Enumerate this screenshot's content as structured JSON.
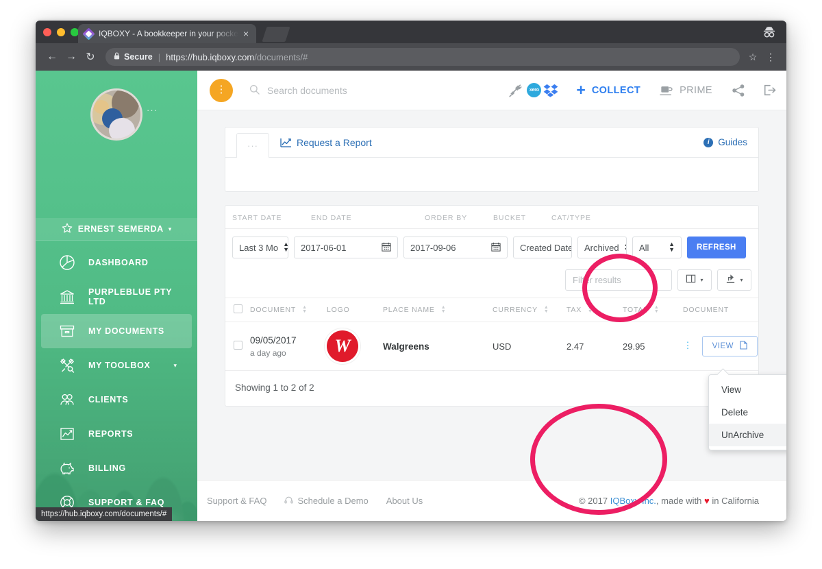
{
  "browser": {
    "tab_title": "IQBOXY - A bookkeeper in your pocket",
    "tab_close": "×",
    "back_icon": "←",
    "forward_icon": "→",
    "reload_icon": "↻",
    "lock_icon": "🔒",
    "secure_label": "Secure",
    "separator": "|",
    "url_scheme": "https://",
    "url_host": "hub.iqboxy.com",
    "url_path": "/documents/#",
    "star_icon": "☆",
    "menu_icon": "⋮",
    "incognito_icon": "incognito-icon",
    "status_url": "https://hub.iqboxy.com/documents/#"
  },
  "sidebar": {
    "avatar_alt": "user-avatar",
    "avatar_dots": "···",
    "user_name": "ERNEST SEMERDA",
    "user_star": "☆",
    "user_caret": "▾",
    "items": [
      {
        "label": "DASHBOARD",
        "icon": "pie-chart-icon",
        "active": false,
        "caret": ""
      },
      {
        "label": "PURPLEBLUE PTY LTD",
        "icon": "bank-icon",
        "active": false,
        "caret": ""
      },
      {
        "label": "MY DOCUMENTS",
        "icon": "box-icon",
        "active": true,
        "caret": ""
      },
      {
        "label": "MY TOOLBOX",
        "icon": "tools-icon",
        "active": false,
        "caret": "▾"
      },
      {
        "label": "CLIENTS",
        "icon": "people-icon",
        "active": false,
        "caret": ""
      },
      {
        "label": "REPORTS",
        "icon": "graph-icon",
        "active": false,
        "caret": ""
      },
      {
        "label": "BILLING",
        "icon": "piggybank-icon",
        "active": false,
        "caret": ""
      },
      {
        "label": "SUPPORT & FAQ",
        "icon": "lifering-icon",
        "active": false,
        "caret": ""
      }
    ]
  },
  "appbar": {
    "menu_dots": "⋮",
    "search_placeholder": "Search documents",
    "search_value": "",
    "plug_icon": "plug-icon",
    "xero_label": "xero",
    "dropbox_icon": "dropbox-icon",
    "collect_plus": "+",
    "collect_label": "COLLECT",
    "prime_label": "PRIME",
    "prime_icon": "coffee-cup-icon",
    "share_icon": "share-icon",
    "logout_icon": "logout-icon"
  },
  "report_card": {
    "ellipsis": "···",
    "request_report": "Request a Report",
    "guides": "Guides",
    "guides_badge": "i"
  },
  "filters": {
    "headers": [
      "START DATE",
      "END DATE",
      "ORDER BY",
      "BUCKET",
      "CAT/TYPE"
    ],
    "range_value": "Last 3 Mo",
    "start_date": "2017-06-01",
    "end_date": "2017-09-06",
    "order_by": "Created Date",
    "bucket": "Archived",
    "cat_type": "All",
    "refresh_label": "REFRESH",
    "calendar_icon": "calendar-icon"
  },
  "table_toolbar": {
    "filter_placeholder": "Filter results",
    "filter_value": "",
    "columns_icon": "columns-icon",
    "export_icon": "export-icon",
    "caret": "▾"
  },
  "table": {
    "columns": [
      {
        "label": "",
        "sortable": false
      },
      {
        "label": "DOCUMENT",
        "sortable": true
      },
      {
        "label": "LOGO",
        "sortable": false
      },
      {
        "label": "PLACE NAME",
        "sortable": true
      },
      {
        "label": "CURRENCY",
        "sortable": true
      },
      {
        "label": "TAX",
        "sortable": true
      },
      {
        "label": "TOTAL",
        "sortable": true
      },
      {
        "label": "DOCUMENT",
        "sortable": false
      }
    ],
    "rows": [
      {
        "checked": false,
        "date": "09/05/2017",
        "ago": "a day ago",
        "logo_letter": "W",
        "logo_color": "#e01a2b",
        "place": "Walgreens",
        "currency": "USD",
        "tax": "2.47",
        "total": "29.95",
        "kebab": "⋮",
        "view_label": "VIEW",
        "view_icon": "document-icon"
      }
    ],
    "showing": "Showing 1 to 2 of 2"
  },
  "context_menu": {
    "items": [
      {
        "label": "View",
        "highlighted": false
      },
      {
        "label": "Delete",
        "highlighted": false
      },
      {
        "label": "UnArchive",
        "highlighted": true
      }
    ]
  },
  "footer": {
    "links": [
      {
        "label": "Support & FAQ",
        "icon": ""
      },
      {
        "label": "Schedule a Demo",
        "icon": "headset-icon"
      },
      {
        "label": "About Us",
        "icon": ""
      }
    ],
    "copyright_pre": "© 2017 ",
    "company": "IQBoxy Inc.",
    "copyright_mid": ", made with ",
    "heart": "♥",
    "copyright_post": " in California"
  },
  "annotations": {
    "accent_color": "#ec1e63",
    "circles": [
      "bucket-filter-highlight",
      "row-actions-menu-highlight"
    ]
  }
}
